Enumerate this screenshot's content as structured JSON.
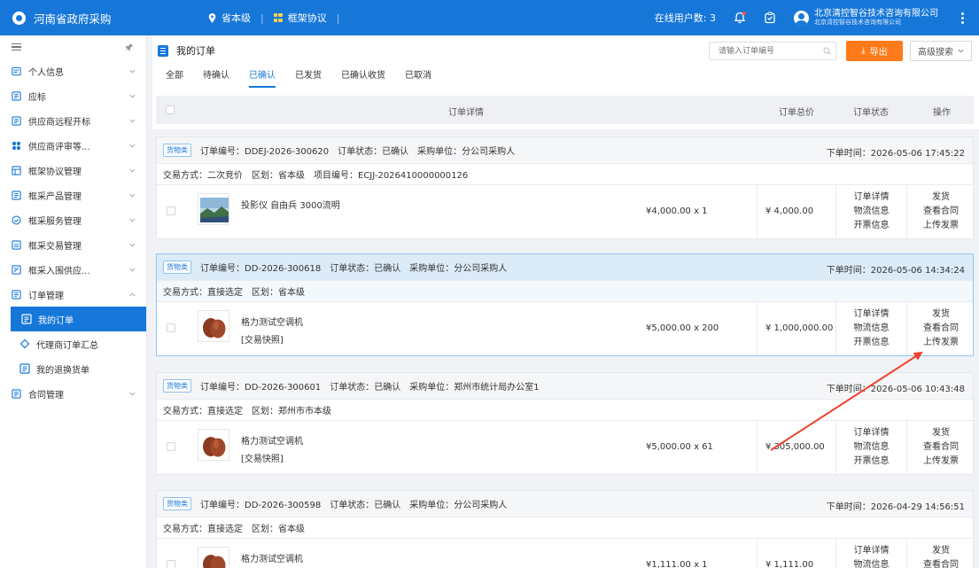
{
  "app": {
    "title": "河南省政府采购",
    "nav": [
      {
        "label": "省本级",
        "icon": "location-pin-icon"
      },
      {
        "label": "框架协议",
        "icon": "grid-icon"
      }
    ],
    "online_label": "在线用户数: 3",
    "company_name": "北京清控智谷技术咨询有限公司",
    "company_sub": "北京清控智谷技术咨询有限公司"
  },
  "sidebar": {
    "items": [
      {
        "label": "个人信息",
        "icon": "person-icon"
      },
      {
        "label": "应标",
        "icon": "bid-icon"
      },
      {
        "label": "供应商远程开标",
        "icon": "remote-bid-icon"
      },
      {
        "label": "供应商评审等...",
        "icon": "review-icon"
      },
      {
        "label": "框架协议管理",
        "icon": "agreement-icon"
      },
      {
        "label": "框采产品管理",
        "icon": "product-icon"
      },
      {
        "label": "框采服务管理",
        "icon": "service-icon"
      },
      {
        "label": "框采交易管理",
        "icon": "trade-icon"
      },
      {
        "label": "框采入围供应...",
        "icon": "shortlist-icon"
      },
      {
        "label": "订单管理",
        "icon": "order-icon"
      }
    ],
    "sub_items": [
      {
        "label": "我的订单",
        "active": true
      },
      {
        "label": "代理商订单汇总",
        "active": false
      },
      {
        "label": "我的退换货单",
        "active": false
      }
    ],
    "last_item": {
      "label": "合同管理",
      "icon": "contract-icon"
    }
  },
  "page": {
    "title": "我的订单",
    "search_placeholder": "请输入订单编号",
    "export_label": "导出",
    "advanced_label": "高级搜索",
    "tabs": [
      "全部",
      "待确认",
      "已确认",
      "已发货",
      "已确认收货",
      "已取消"
    ],
    "active_tab": 2
  },
  "table": {
    "col_details": "订单详情",
    "col_total": "订单总价",
    "col_status": "订单状态",
    "col_action": "操作"
  },
  "orders": [
    {
      "tag": "货物类",
      "order_no": "订单编号：DDEJ-2026-300620",
      "status": "订单状态：已确认",
      "buyer": "采购单位：分公司采购人",
      "time": "下单时间：2026-05-06 17:45:22",
      "trade": "交易方式：二次竞价",
      "region": "区划：省本级",
      "project": "项目编号：ECJJ-2026410000000126",
      "product": "投影仪 自由兵 3000流明",
      "snapshot": "",
      "price": "¥4,000.00 x 1",
      "total": "¥ 4,000.00",
      "status_links": [
        "订单详情",
        "物流信息",
        "开票信息"
      ],
      "action_links": [
        "发货",
        "查看合同",
        "上传发票"
      ]
    },
    {
      "tag": "货物类",
      "order_no": "订单编号：DD-2026-300618",
      "status": "订单状态：已确认",
      "buyer": "采购单位：分公司采购人",
      "time": "下单时间：2026-05-06 14:34:24",
      "trade": "交易方式：直接选定",
      "region": "区划：省本级",
      "project": "",
      "product": "格力测试空调机",
      "snapshot": "[交易快照]",
      "price": "¥5,000.00 x 200",
      "total": "¥ 1,000,000.00",
      "status_links": [
        "订单详情",
        "物流信息",
        "开票信息"
      ],
      "action_links": [
        "发货",
        "查看合同",
        "上传发票"
      ]
    },
    {
      "tag": "货物类",
      "order_no": "订单编号：DD-2026-300601",
      "status": "订单状态：已确认",
      "buyer": "采购单位：郑州市统计局办公室1",
      "time": "下单时间：2026-05-06 10:43:48",
      "trade": "交易方式：直接选定",
      "region": "区划：郑州市市本级",
      "project": "",
      "product": "格力测试空调机",
      "snapshot": "[交易快照]",
      "price": "¥5,000.00 x 61",
      "total": "¥ 305,000.00",
      "status_links": [
        "订单详情",
        "物流信息",
        "开票信息"
      ],
      "action_links": [
        "发货",
        "查看合同",
        "上传发票"
      ]
    },
    {
      "tag": "货物类",
      "order_no": "订单编号：DD-2026-300598",
      "status": "订单状态：已确认",
      "buyer": "采购单位：分公司采购人",
      "time": "下单时间：2026-04-29 14:56:51",
      "trade": "交易方式：直接选定",
      "region": "区划：省本级",
      "project": "",
      "product": "格力测试空调机",
      "snapshot": "",
      "price": "¥1,111.00 x 1",
      "total": "¥ 1,111.00",
      "status_links": [
        "订单详情",
        "物流信息"
      ],
      "action_links": [
        "发货",
        "查看合同"
      ]
    }
  ],
  "colors": {
    "primary": "#1677d9",
    "accent_orange": "#ff7a1a",
    "annotation_arrow": "#f0412e"
  }
}
